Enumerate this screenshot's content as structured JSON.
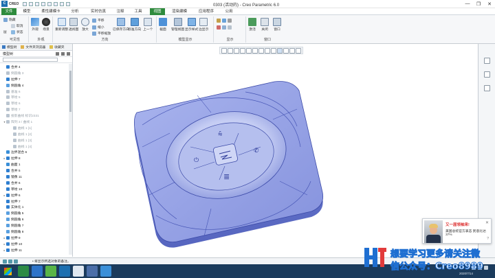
{
  "window": {
    "brand": "CREO",
    "title": "0303 (活动的) - Creo Parametric 6.0",
    "minimize": "—",
    "maximize": "❐",
    "close": "✕"
  },
  "tabs": [
    "文件",
    "模型",
    "柔性建模卡",
    "分析",
    "实时仿真",
    "注释",
    "工具",
    "视图",
    "渲染建模",
    "应用程序",
    "公用"
  ],
  "active_tab": "视图",
  "ribbon": {
    "groups": [
      "可见性",
      "外观",
      "方向",
      "模型显示",
      "显示",
      "窗口"
    ],
    "buttons": {
      "hide": "隐藏",
      "show": "取消",
      "status": "状态",
      "layer": "层",
      "appearance": "外观",
      "scene": "场景",
      "perspective": "透视图",
      "refit": "重新调整",
      "zoom": "放大",
      "zoom_in": "缩小",
      "pan": "平移",
      "pan_zoom": "平移缩放",
      "saved_views": "已保存方向",
      "standard": "标准方向",
      "prev": "上一个",
      "section": "截面",
      "manage_views": "管理视图",
      "display_style": "显示样式",
      "edge": "边显示",
      "activate": "激活",
      "close": "关闭",
      "window": "窗口"
    }
  },
  "left_panel": {
    "tabs": [
      "模型树",
      "文件夹浏览器",
      "收藏夹"
    ],
    "tree_header": "模型树",
    "items": [
      {
        "label": "合并 4",
        "grey": false,
        "icon": "#2f7fd0",
        "exp": ""
      },
      {
        "label": "倒圆角 3",
        "grey": true,
        "icon": "#b9c4cf",
        "exp": ""
      },
      {
        "label": "拉伸 7",
        "grey": false,
        "icon": "#2f7fd0",
        "exp": ""
      },
      {
        "label": "倒圆角 4",
        "grey": false,
        "icon": "#5aa0e0",
        "exp": ""
      },
      {
        "label": "基准 6",
        "grey": true,
        "icon": "#b9c4cf",
        "exp": ""
      },
      {
        "label": "草绘 5",
        "grey": true,
        "icon": "#b9c4cf",
        "exp": ""
      },
      {
        "label": "草绘 6",
        "grey": true,
        "icon": "#b9c4cf",
        "exp": ""
      },
      {
        "label": "草绘 7",
        "grey": true,
        "icon": "#b9c4cf",
        "exp": ""
      },
      {
        "label": "投影曲线 标识2331",
        "grey": true,
        "icon": "#b9c4cf",
        "exp": ""
      },
      {
        "label": "阵列 3 / 曲线 1",
        "grey": true,
        "icon": "#b9c4cf",
        "exp": "▾"
      },
      {
        "label": "曲线 1 [1]",
        "grey": true,
        "icon": "#b9c4cf",
        "exp": ""
      },
      {
        "label": "曲线 1 [2]",
        "grey": true,
        "icon": "#b9c4cf",
        "exp": ""
      },
      {
        "label": "曲线 1 [3]",
        "grey": true,
        "icon": "#b9c4cf",
        "exp": ""
      },
      {
        "label": "曲线 1 [4]",
        "grey": true,
        "icon": "#b9c4cf",
        "exp": ""
      },
      {
        "label": "边界混合 6",
        "grey": false,
        "icon": "#3a8fd8",
        "exp": ""
      },
      {
        "label": "拉伸 8",
        "grey": false,
        "icon": "#2f7fd0",
        "exp": "▸"
      },
      {
        "label": "曲面 1",
        "grey": false,
        "icon": "#3a8fd8",
        "exp": ""
      },
      {
        "label": "合并 5",
        "grey": false,
        "icon": "#2f7fd0",
        "exp": ""
      },
      {
        "label": "镜像 11",
        "grey": false,
        "icon": "#2f7fd0",
        "exp": ""
      },
      {
        "label": "合并 6",
        "grey": false,
        "icon": "#2f7fd0",
        "exp": ""
      },
      {
        "label": "草绘 10",
        "grey": false,
        "icon": "#2f7fd0",
        "exp": ""
      },
      {
        "label": "拉伸 6",
        "grey": false,
        "icon": "#2f7fd0",
        "exp": "▸"
      },
      {
        "label": "拉伸 7",
        "grey": false,
        "icon": "#2f7fd0",
        "exp": ""
      },
      {
        "label": "实体化 1",
        "grey": false,
        "icon": "#2f7fd0",
        "exp": ""
      },
      {
        "label": "倒圆角 5",
        "grey": false,
        "icon": "#5aa0e0",
        "exp": ""
      },
      {
        "label": "倒圆角 6",
        "grey": false,
        "icon": "#5aa0e0",
        "exp": ""
      },
      {
        "label": "倒圆角 7",
        "grey": false,
        "icon": "#5aa0e0",
        "exp": ""
      },
      {
        "label": "倒圆角 8",
        "grey": false,
        "icon": "#5aa0e0",
        "exp": ""
      },
      {
        "label": "拉伸 9",
        "grey": false,
        "icon": "#2f7fd0",
        "exp": "▸"
      },
      {
        "label": "拉伸 10",
        "grey": false,
        "icon": "#2f7fd0",
        "exp": "▸"
      },
      {
        "label": "拉伸 11",
        "grey": false,
        "icon": "#2f7fd0",
        "exp": "▸"
      },
      {
        "label": "拉伸 11",
        "grey": false,
        "icon": "#2f7fd0",
        "exp": "▸"
      }
    ]
  },
  "status": {
    "message": "• 将显示所选对象的备注。"
  },
  "ad": {
    "title": "又一届领袖来!",
    "text": "美国总统官方表态 民意比达37%",
    "close": "✕",
    "more": "?"
  },
  "watermark": {
    "line1": "想要学习更多请关注微",
    "line2": "信公众号：Creo8989"
  },
  "taskbar": {
    "date": "2020/7/14"
  },
  "colors": {
    "accent_green": "#2e8b3d",
    "model_blue": "#8ea0e6",
    "taskbar": "#1b3b5c"
  }
}
